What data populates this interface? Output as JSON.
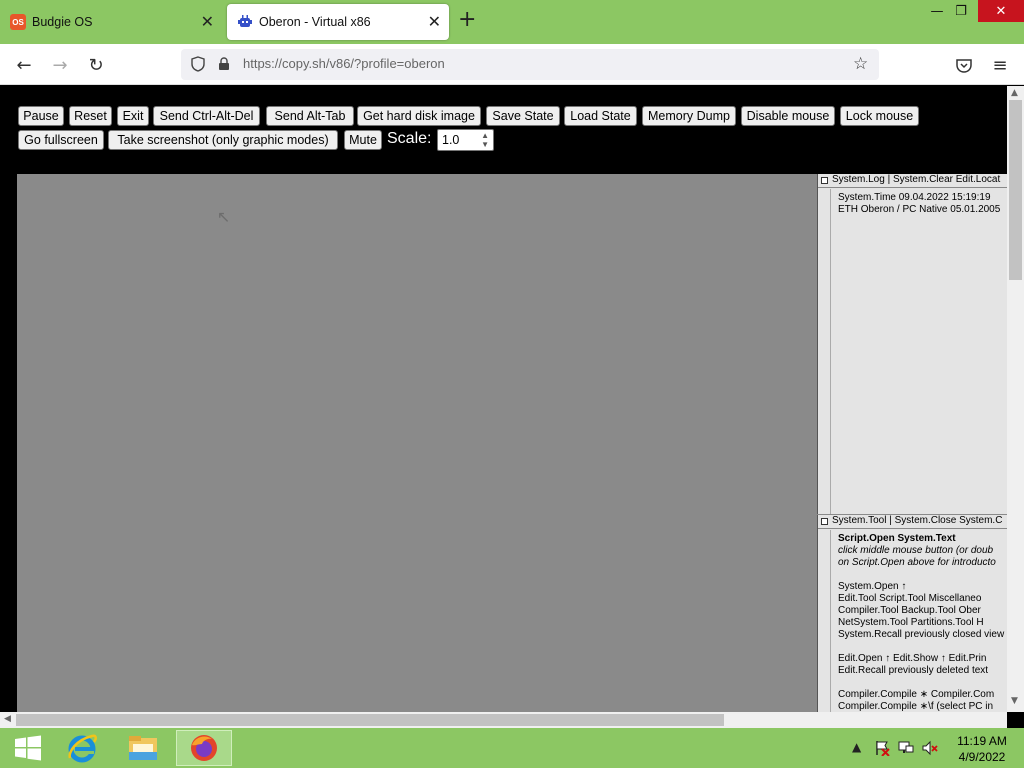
{
  "browser": {
    "tabs": [
      {
        "title": "Budgie OS",
        "favicon": "OS"
      },
      {
        "title": "Oberon - Virtual x86",
        "favicon": "v86-icon"
      }
    ],
    "url": "https://copy.sh/v86/?profile=oberon"
  },
  "toolbar": {
    "row1": [
      "Pause",
      "Reset",
      "Exit",
      "Send Ctrl-Alt-Del",
      "Send Alt-Tab",
      "Get hard disk image",
      "Save State",
      "Load State",
      "Memory Dump",
      "Disable mouse",
      "Lock mouse"
    ],
    "row2": [
      "Go fullscreen",
      "Take screenshot (only graphic modes)",
      "Mute"
    ],
    "scale_label": "Scale:",
    "scale_value": "1.0"
  },
  "oberon": {
    "log_viewer": {
      "title": "System.Log | System.Clear Edit.Locat",
      "lines": [
        "System.Time 09.04.2022 15:19:19",
        "ETH Oberon / PC Native 05.01.2005"
      ]
    },
    "tool_viewer": {
      "title": "System.Tool | System.Close System.C",
      "lines": [
        {
          "text": "Script.Open System.Text",
          "style": "bold"
        },
        {
          "text": "  click middle mouse button (or doub",
          "style": "ital"
        },
        {
          "text": "  on Script.Open above for introducto",
          "style": "ital"
        },
        {
          "text": "",
          "style": ""
        },
        {
          "text": "System.Open ↑",
          "style": ""
        },
        {
          "text": "  Edit.Tool  Script.Tool  Miscellaneo",
          "style": ""
        },
        {
          "text": "  Compiler.Tool  Backup.Tool  Ober",
          "style": ""
        },
        {
          "text": "  NetSystem.Tool  Partitions.Tool  H",
          "style": ""
        },
        {
          "text": "System.Recall previously closed view",
          "style": ""
        },
        {
          "text": "",
          "style": ""
        },
        {
          "text": "Edit.Open ↑  Edit.Show ↑  Edit.Prin",
          "style": ""
        },
        {
          "text": "Edit.Recall previously deleted text",
          "style": ""
        },
        {
          "text": "",
          "style": ""
        },
        {
          "text": "Compiler.Compile ∗  Compiler.Com",
          "style": ""
        },
        {
          "text": "Compiler.Compile ∗\\f  (select PC in",
          "style": ""
        }
      ]
    }
  },
  "taskbar": {
    "time": "11:19 AM",
    "date": "4/9/2022"
  },
  "colors": {
    "chrome_green": "#8cc763",
    "page_bg": "#000000",
    "oberon_bg": "#8a8a8a"
  }
}
